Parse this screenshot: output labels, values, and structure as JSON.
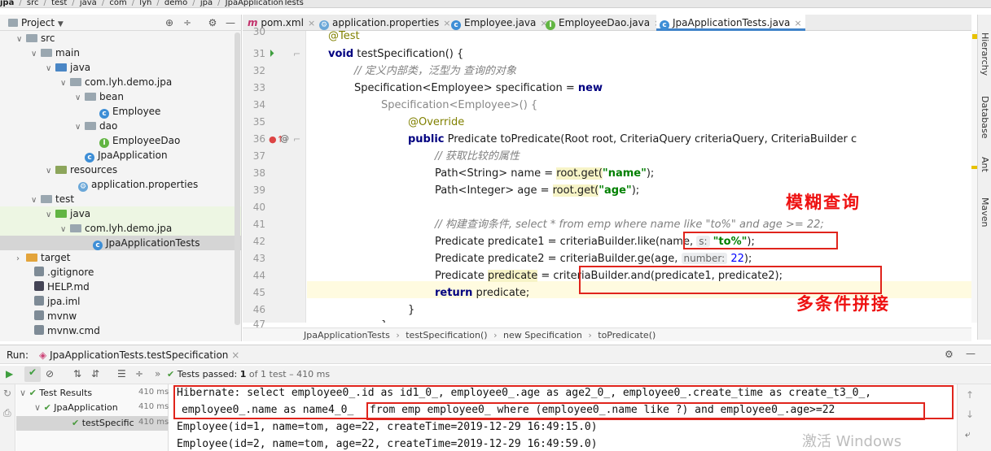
{
  "breadcrumb": [
    "jpa",
    "src",
    "test",
    "java",
    "com",
    "lyh",
    "demo",
    "jpa",
    "JpaApplicationTests"
  ],
  "project": {
    "title": "Project",
    "tree": [
      {
        "label": "src",
        "kind": "folder"
      },
      {
        "label": "main",
        "kind": "folder"
      },
      {
        "label": "java",
        "kind": "src"
      },
      {
        "label": "com.lyh.demo.jpa",
        "kind": "package"
      },
      {
        "label": "bean",
        "kind": "folder"
      },
      {
        "label": "Employee",
        "kind": "class"
      },
      {
        "label": "dao",
        "kind": "folder"
      },
      {
        "label": "EmployeeDao",
        "kind": "interface"
      },
      {
        "label": "JpaApplication",
        "kind": "class"
      },
      {
        "label": "resources",
        "kind": "res"
      },
      {
        "label": "application.properties",
        "kind": "props"
      },
      {
        "label": "test",
        "kind": "folder"
      },
      {
        "label": "java",
        "kind": "test"
      },
      {
        "label": "com.lyh.demo.jpa",
        "kind": "package"
      },
      {
        "label": "JpaApplicationTests",
        "kind": "class"
      },
      {
        "label": "target",
        "kind": "target"
      },
      {
        "label": ".gitignore",
        "kind": "file"
      },
      {
        "label": "HELP.md",
        "kind": "md"
      },
      {
        "label": "jpa.iml",
        "kind": "file"
      },
      {
        "label": "mvnw",
        "kind": "file"
      },
      {
        "label": "mvnw.cmd",
        "kind": "file"
      }
    ]
  },
  "tabs": [
    {
      "label": "pom.xml",
      "icon": "m"
    },
    {
      "label": "application.properties",
      "icon": "p"
    },
    {
      "label": "Employee.java",
      "icon": "c"
    },
    {
      "label": "EmployeeDao.java",
      "icon": "i"
    },
    {
      "label": "JpaApplicationTests.java",
      "icon": "c"
    }
  ],
  "lines": [
    "30",
    "31",
    "32",
    "33",
    "34",
    "35",
    "36",
    "37",
    "38",
    "39",
    "40",
    "41",
    "42",
    "43",
    "44",
    "45",
    "46",
    "47"
  ],
  "code": {
    "l30": "@Test",
    "l31a": "void",
    "l31b": " testSpecification() {",
    "l32": "// 定义内部类，泛型为 查询的对象",
    "l33a": "Specification<Employee> specification = ",
    "l33b": "new",
    "l34": "Specification<Employee>() {",
    "l35": "@Override",
    "l36a": "public",
    "l36b": " Predicate toPredicate(Root root, CriteriaQuery criteriaQuery, CriteriaBuilder c",
    "l37": "// 获取比较的属性",
    "l38a": "Path<String> name = ",
    "l38b": "root.get(",
    "l38c": "\"name\"",
    "l38d": ");",
    "l39a": "Path<Integer> age = ",
    "l39b": "root.get(",
    "l39c": "\"age\"",
    "l39d": ");",
    "l41": "// 构建查询条件, select * from emp where name like \"to%\" and age >= 22;",
    "l42a": "Predicate predicate1 = criteriaBuilder.like(name,",
    "l42h": "s:",
    "l42s": "\"to%\"",
    "l42d": ");",
    "l43a": "Predicate predicate2 = criteriaBuilder.ge(age,",
    "l43h": "number:",
    "l43n": "22",
    "l43d": ");",
    "l44a": "Predicate ",
    "l44b": "predicate",
    "l44c": " = criteriaBuilder.and(predicate1, predicate2);",
    "l45a": "return",
    "l45b": " predicate;",
    "l46": "}",
    "l47": "};"
  },
  "annotations": {
    "fuzzy": "模糊查询",
    "multi": "多条件拼接"
  },
  "editor_breadcrumb": [
    "JpaApplicationTests",
    "testSpecification()",
    "new Specification",
    "toPredicate()"
  ],
  "right_tools": [
    "Hierarchy",
    "Database",
    "Ant",
    "Maven"
  ],
  "run": {
    "label": "Run:",
    "config": "JpaApplicationTests.testSpecification",
    "status_prefix": "Tests passed:",
    "status_count": "1",
    "status_suffix": "of 1 test – 410 ms",
    "tests": [
      {
        "name": "Test Results",
        "time": "410 ms"
      },
      {
        "name": "JpaApplication",
        "time": "410 ms"
      },
      {
        "name": "testSpecific",
        "time": "410 ms"
      }
    ],
    "console": [
      "Hibernate: select employee0_.id as id1_0_, employee0_.age as age2_0_, employee0_.create_time as create_t3_0_,",
      "employee0_.name as name4_0_",
      "from emp employee0_ where (employee0_.name like ?) and employee0_.age>=22",
      "Employee(id=1, name=tom, age=22, createTime=2019-12-29 16:49:15.0)",
      "Employee(id=2, name=tom, age=22, createTime=2019-12-29 16:49:59.0)"
    ]
  },
  "watermark": "激活 Windows"
}
